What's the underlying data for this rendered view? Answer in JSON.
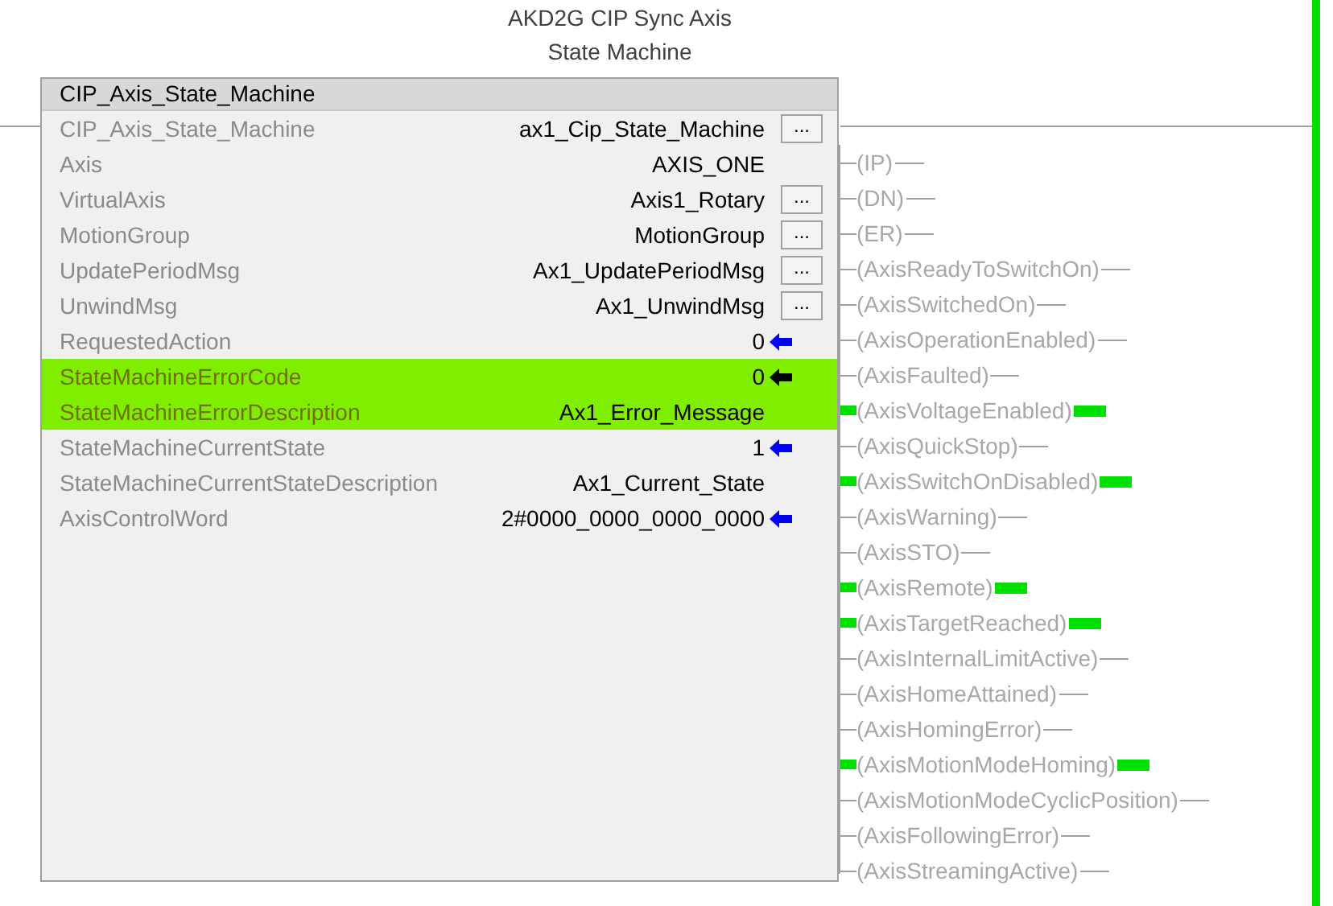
{
  "title": [
    "AKD2G CIP Sync Axis",
    "State Machine"
  ],
  "block": {
    "name": "CIP_Axis_State_Machine",
    "rows": [
      {
        "name": "CIP_Axis_State_Machine",
        "value": "ax1_Cip_State_Machine",
        "kind": "browse",
        "button": "...",
        "highlighted": false
      },
      {
        "name": "Axis",
        "value": "AXIS_ONE",
        "kind": "plain",
        "highlighted": false
      },
      {
        "name": "VirtualAxis",
        "value": "Axis1_Rotary",
        "kind": "browse",
        "button": "...",
        "highlighted": false
      },
      {
        "name": "MotionGroup",
        "value": "MotionGroup",
        "kind": "browse",
        "button": "...",
        "highlighted": false
      },
      {
        "name": "UpdatePeriodMsg",
        "value": "Ax1_UpdatePeriodMsg",
        "kind": "browse",
        "button": "...",
        "highlighted": false
      },
      {
        "name": "UnwindMsg",
        "value": "Ax1_UnwindMsg",
        "kind": "browse",
        "button": "...",
        "highlighted": false
      },
      {
        "name": "RequestedAction",
        "value": "0",
        "kind": "arrow",
        "color": "#0000ff",
        "highlighted": false
      },
      {
        "name": "StateMachineErrorCode",
        "value": "0",
        "kind": "arrow",
        "color": "#000000",
        "highlighted": true
      },
      {
        "name": "StateMachineErrorDescription",
        "value": "Ax1_Error_Message",
        "kind": "plain",
        "highlighted": true
      },
      {
        "name": "StateMachineCurrentState",
        "value": "1",
        "kind": "arrow",
        "color": "#0000ff",
        "highlighted": false
      },
      {
        "name": "StateMachineCurrentStateDescription",
        "value": "Ax1_Current_State",
        "kind": "plain",
        "highlighted": false
      },
      {
        "name": "AxisControlWord",
        "value": "2#0000_0000_0000_0000",
        "kind": "arrow",
        "color": "#0000ff",
        "highlighted": false
      }
    ]
  },
  "outputs": [
    {
      "label": "(IP)",
      "energized": false
    },
    {
      "label": "(DN)",
      "energized": false
    },
    {
      "label": "(ER)",
      "energized": false
    },
    {
      "label": "(AxisReadyToSwitchOn)",
      "energized": false
    },
    {
      "label": "(AxisSwitchedOn)",
      "energized": false
    },
    {
      "label": "(AxisOperationEnabled)",
      "energized": false
    },
    {
      "label": "(AxisFaulted)",
      "energized": false
    },
    {
      "label": "(AxisVoltageEnabled)",
      "energized": true
    },
    {
      "label": "(AxisQuickStop)",
      "energized": false
    },
    {
      "label": "(AxisSwitchOnDisabled)",
      "energized": true
    },
    {
      "label": "(AxisWarning)",
      "energized": false
    },
    {
      "label": "(AxisSTO)",
      "energized": false
    },
    {
      "label": "(AxisRemote)",
      "energized": true
    },
    {
      "label": "(AxisTargetReached)",
      "energized": true
    },
    {
      "label": "(AxisInternalLimitActive)",
      "energized": false
    },
    {
      "label": "(AxisHomeAttained)",
      "energized": false
    },
    {
      "label": "(AxisHomingError)",
      "energized": false
    },
    {
      "label": "(AxisMotionModeHoming)",
      "energized": true
    },
    {
      "label": "(AxisMotionModeCyclicPosition)",
      "energized": false
    },
    {
      "label": "(AxisFollowingError)",
      "energized": false
    },
    {
      "label": "(AxisStreamingActive)",
      "energized": false
    }
  ]
}
